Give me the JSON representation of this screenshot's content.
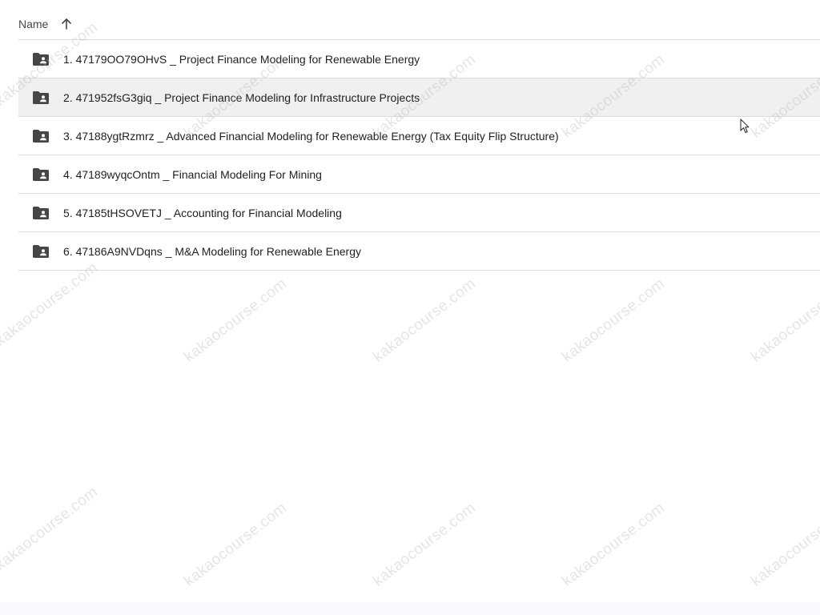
{
  "header": {
    "name_label": "Name",
    "sort_icon": "arrow-up-icon"
  },
  "files": [
    {
      "label": "1. 47179OO79OHvS _ Project Finance Modeling for Renewable Energy",
      "icon": "shared-folder-icon"
    },
    {
      "label": "2. 471952fsG3giq _ Project Finance Modeling for Infrastructure Projects",
      "icon": "shared-folder-icon"
    },
    {
      "label": "3. 47188ygtRzmrz _ Advanced Financial Modeling for Renewable Energy (Tax Equity Flip Structure)",
      "icon": "shared-folder-icon"
    },
    {
      "label": "4. 47189wyqcOntm _ Financial Modeling For Mining",
      "icon": "shared-folder-icon"
    },
    {
      "label": "5. 47185tHSOVETJ _ Accounting for Financial Modeling",
      "icon": "shared-folder-icon"
    },
    {
      "label": "6. 47186A9NVDqns _ M&A Modeling for Renewable Energy",
      "icon": "shared-folder-icon"
    }
  ],
  "watermark": {
    "text": "kakaocourse.com"
  },
  "colors": {
    "row_hover": "#f0f0f0",
    "divider": "#dadce0",
    "icon": "#444746"
  }
}
